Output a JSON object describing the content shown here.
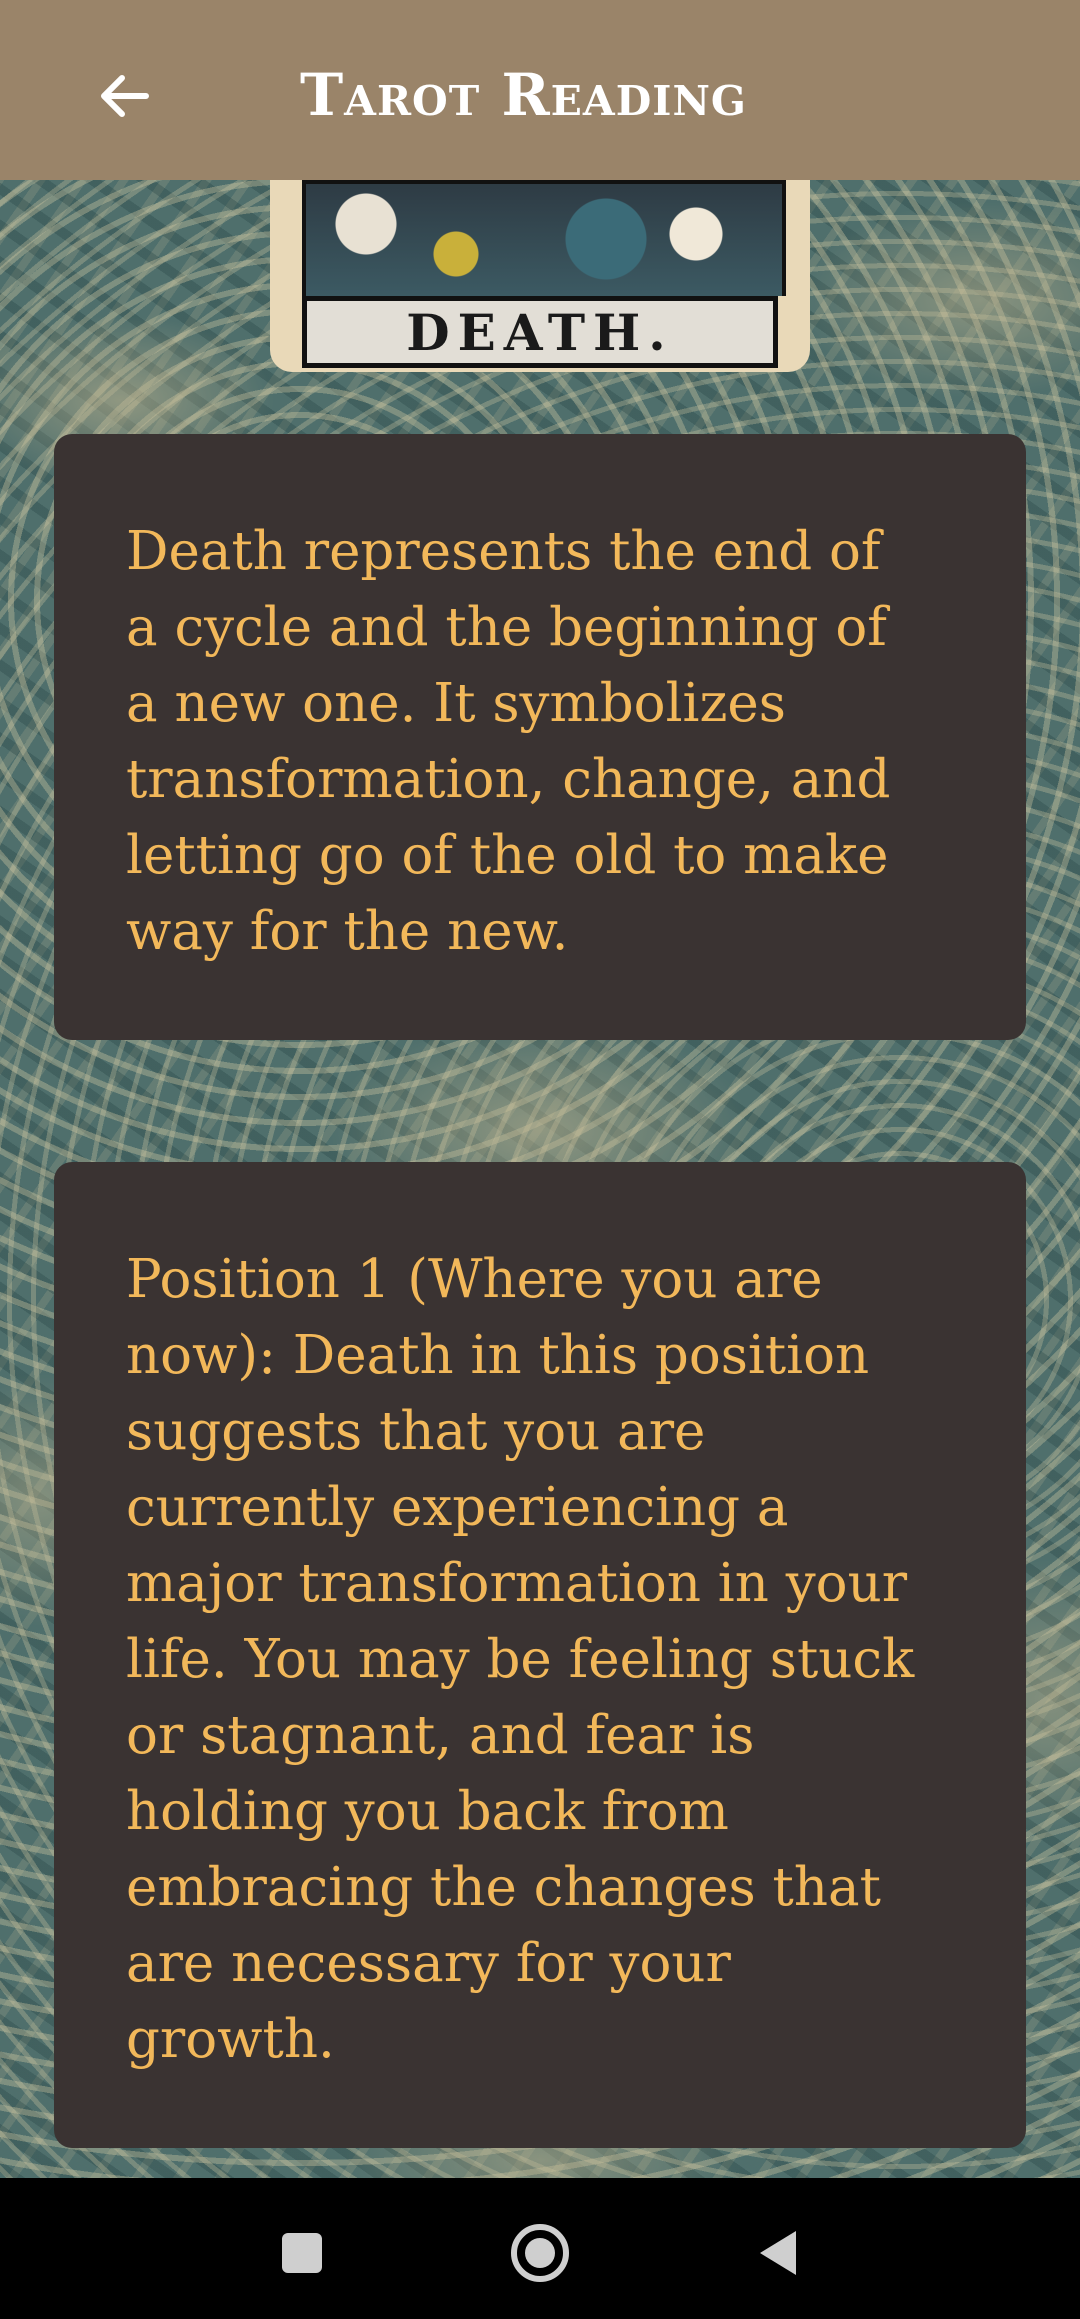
{
  "app_bar": {
    "title": "Tarot Reading",
    "back_icon": "arrow-left-icon"
  },
  "card": {
    "name_label": "DEATH."
  },
  "panels": [
    {
      "text": "Death represents the end of a cycle and the beginning of a new one. It symbolizes transformation, change, and letting go of the old to make way for the new."
    },
    {
      "text": "Position 1 (Where you are now): Death in this position suggests that you are currently experiencing a major transformation in your life. You may be feeling stuck or stagnant, and fear is holding you back from embracing the changes that are necessary for your growth."
    }
  ],
  "nav_bar": {
    "recents_icon": "square-recents-icon",
    "home_icon": "circle-home-icon",
    "back_icon": "triangle-back-icon"
  },
  "colors": {
    "app_bar": "#9a8469",
    "panel_background": "#3a3332",
    "panel_text": "#f2b85a",
    "background": "#4f6f6c"
  }
}
